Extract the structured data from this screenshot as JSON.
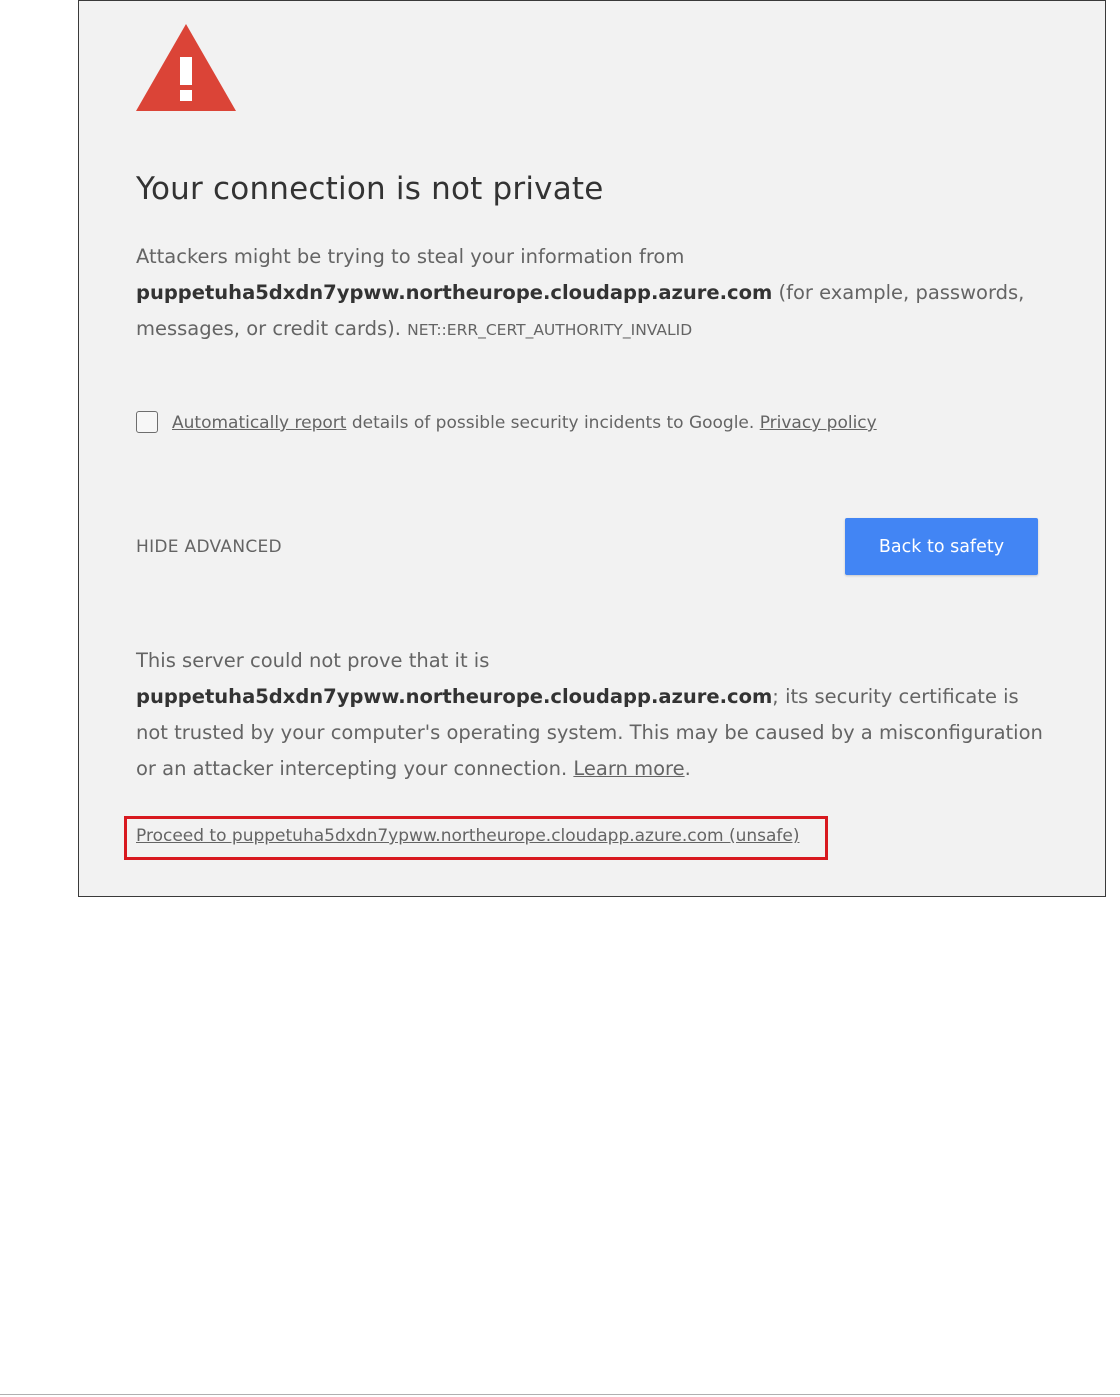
{
  "page": {
    "title": "Your connection is not private",
    "domain": "puppetuha5dxdn7ypww.northeurope.cloudapp.azure.com"
  },
  "intro": {
    "prefix": "Attackers might be trying to steal your information from ",
    "suffix": " (for example, passwords, messages, or credit cards). ",
    "error_code": "NET::ERR_CERT_AUTHORITY_INVALID"
  },
  "report": {
    "checked": false,
    "link_label": "Automatically report",
    "middle_text": " details of possible security incidents to Google. ",
    "privacy_label": "Privacy policy"
  },
  "actions": {
    "hide_advanced_label": "HIDE ADVANCED",
    "back_to_safety_label": "Back to safety"
  },
  "details": {
    "prefix": "This server could not prove that it is ",
    "suffix": "; its security certificate is not trusted by your computer's operating system. This may be caused by a misconfiguration or an attacker intercepting your connection. ",
    "learn_more_label": "Learn more",
    "end": "."
  },
  "proceed": {
    "label": "Proceed to puppetuha5dxdn7ypww.northeurope.cloudapp.azure.com (unsafe)"
  },
  "colors": {
    "warning_red": "#db4437",
    "button_blue": "#4285f4",
    "highlight_red": "#d8191f",
    "background": "#f2f2f2",
    "text": "#646464"
  },
  "icons": {
    "warning": "warning-triangle-icon",
    "checkbox": "checkbox-unchecked-icon"
  }
}
